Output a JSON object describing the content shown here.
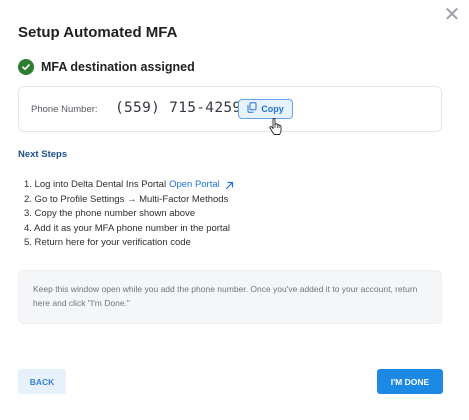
{
  "dialog": {
    "title": "Setup Automated MFA",
    "close_icon": "close-icon"
  },
  "status": {
    "text": "MFA destination assigned",
    "icon": "check-circle-icon",
    "color": "#2e7d32"
  },
  "phone": {
    "label": "Phone Number:",
    "value": "(559) 715-4259",
    "copy_label": "Copy",
    "copy_icon": "copy-icon"
  },
  "next_steps": {
    "heading": "Next Steps",
    "steps": [
      {
        "text": "1. Log into Delta Dental Ins Portal",
        "link": "Open Portal"
      },
      {
        "text": "2. Go to Profile Settings → Multi-Factor Methods"
      },
      {
        "text": "3. Copy the phone number shown above"
      },
      {
        "text": "4. Add it as your MFA phone number in the portal"
      },
      {
        "text": "5. Return here for your verification code"
      }
    ]
  },
  "info": {
    "text": "Keep this window open while you add the phone number. Once you've added it to your account, return here and click \"I'm Done.\""
  },
  "actions": {
    "back_label": "BACK",
    "done_label": "I'M DONE"
  },
  "colors": {
    "accent": "#1e88e5",
    "link": "#1e73d8",
    "heading": "#1f4f8a"
  }
}
